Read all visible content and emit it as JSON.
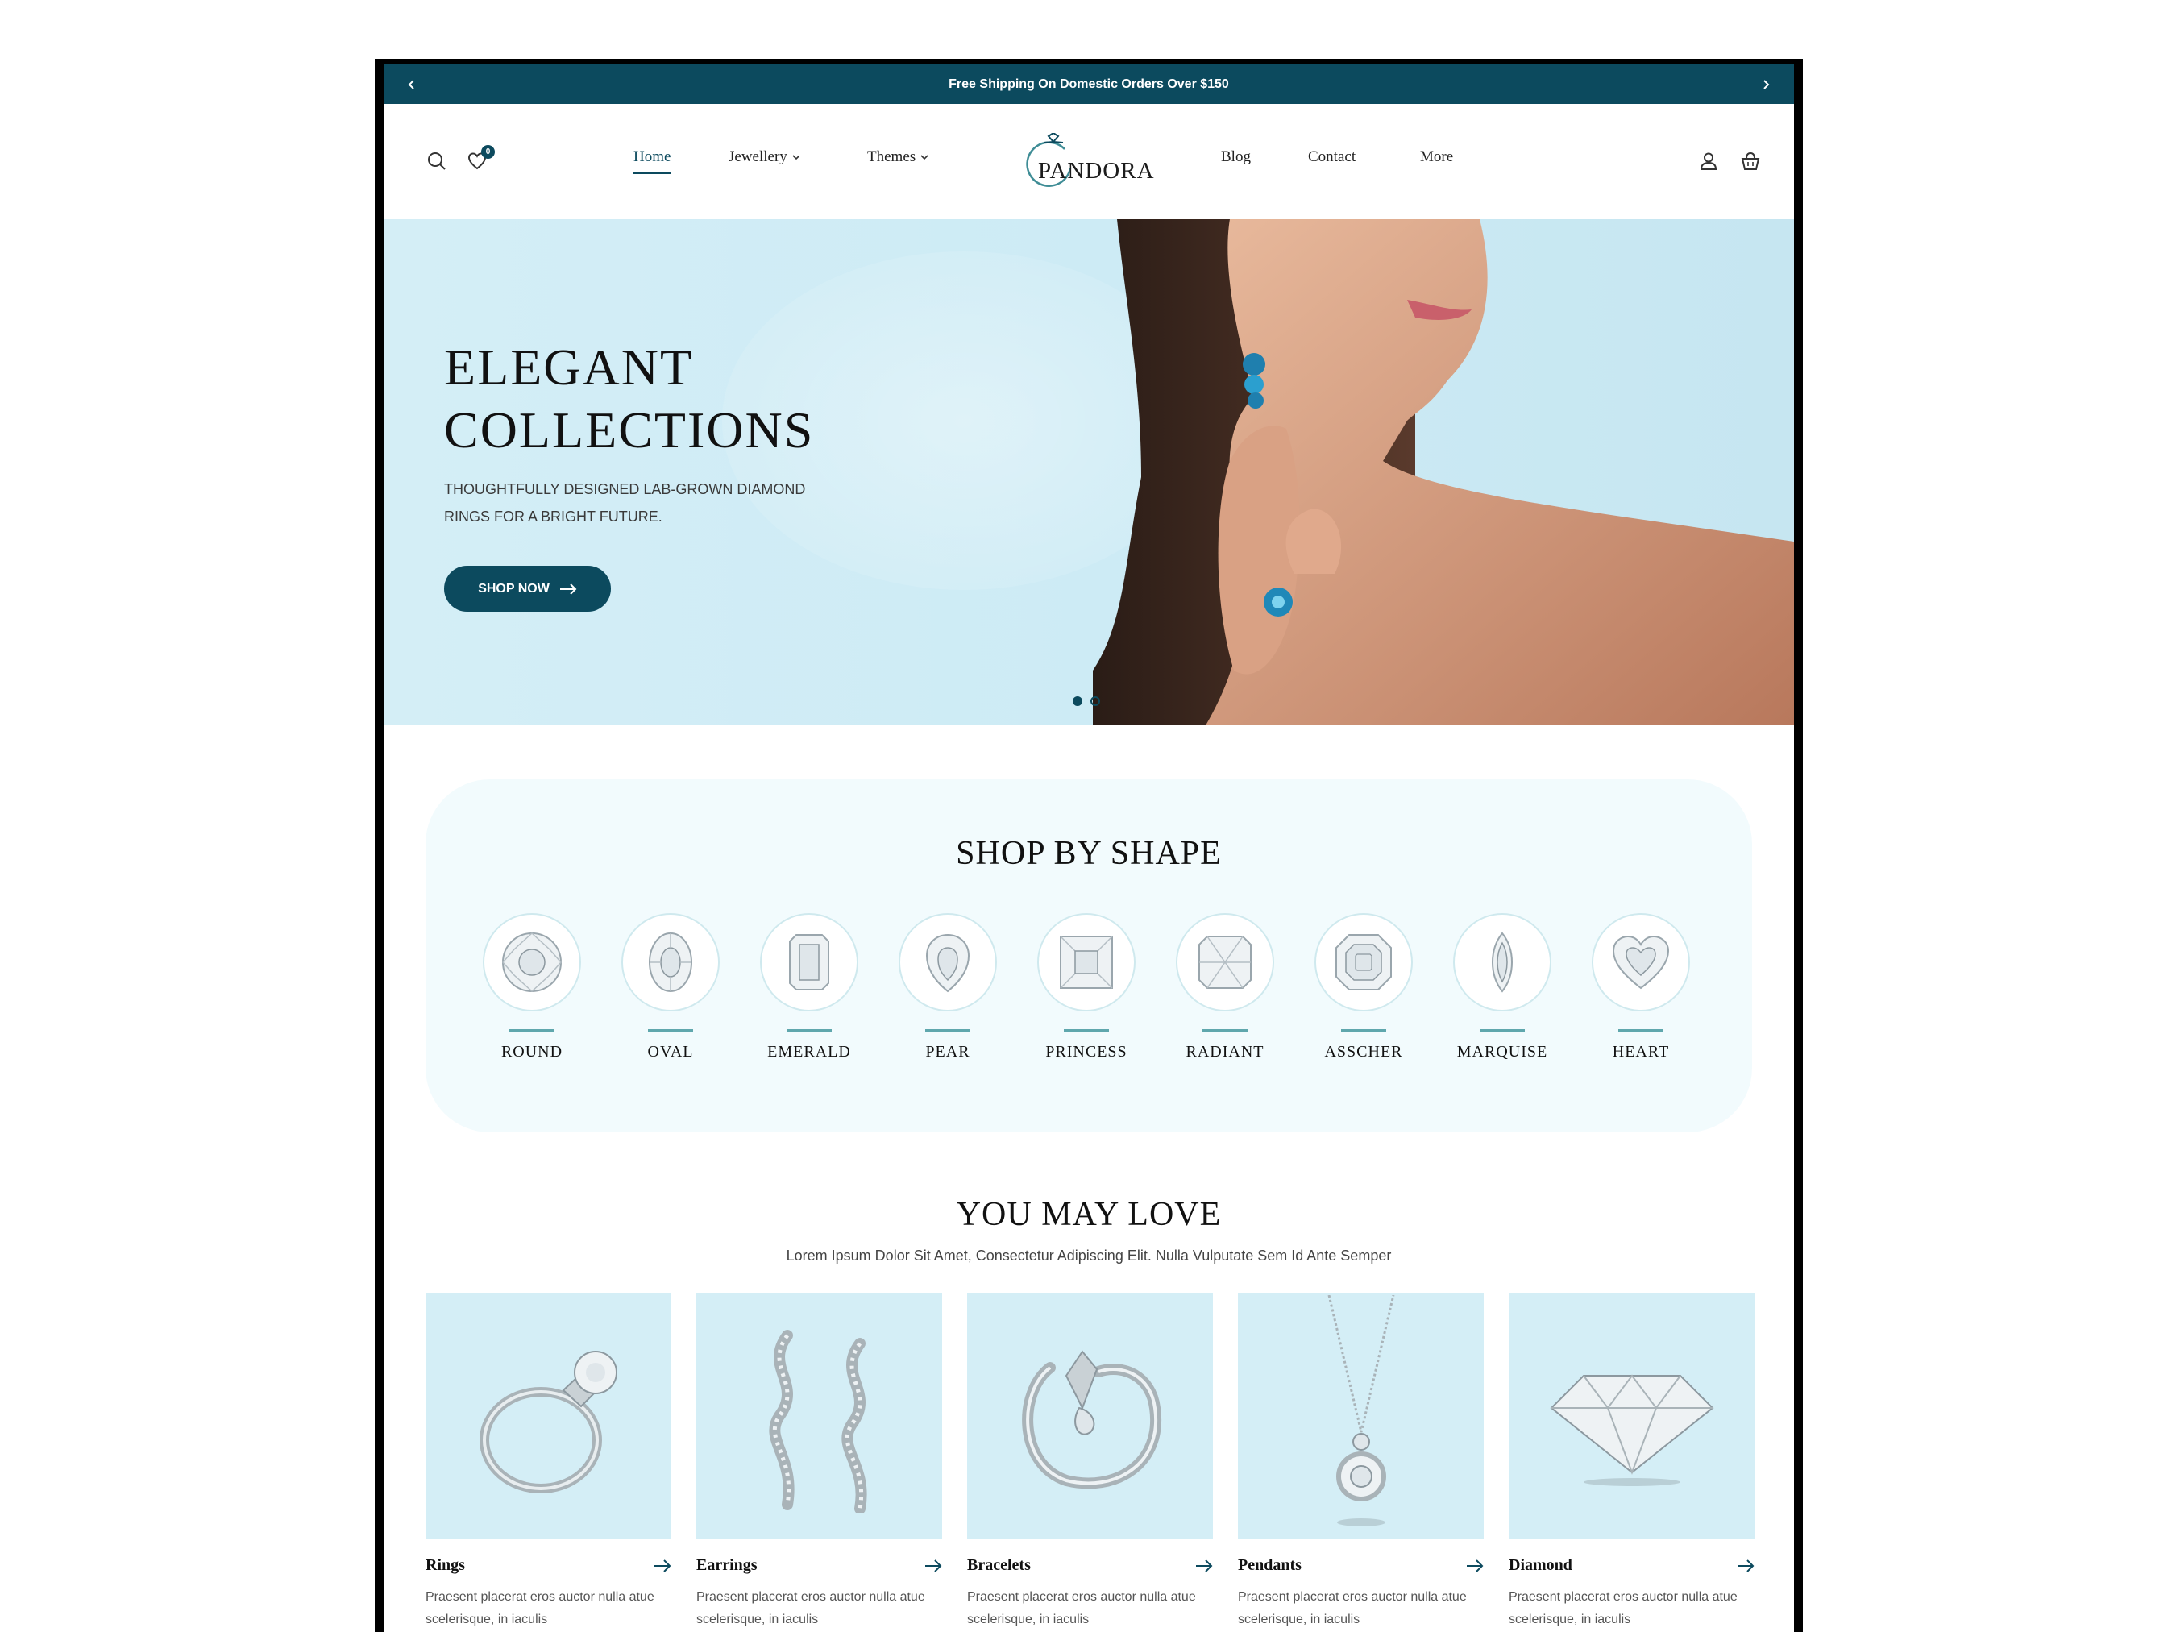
{
  "announcement": {
    "message": "Free Shipping On Domestic Orders Over $150",
    "prev_icon": "chevron-left-icon",
    "next_icon": "chevron-right-icon"
  },
  "header": {
    "logo": "PANDORA",
    "wishlist_count": "0",
    "nav": [
      {
        "label": "Home",
        "active": true
      },
      {
        "label": "Jewellery",
        "dropdown": true
      },
      {
        "label": "Themes",
        "dropdown": true
      },
      {
        "label": "Blog"
      },
      {
        "label": "Contact"
      },
      {
        "label": "More"
      }
    ],
    "icons": [
      "search-icon",
      "heart-icon",
      "user-icon",
      "shopping-bag-icon"
    ]
  },
  "hero": {
    "title_line1": "ELEGANT",
    "title_line2": "COLLECTIONS",
    "subtitle": "Thoughtfully designed lab-grown diamond rings for a bright future.",
    "button_label": "SHOP NOW",
    "slides": 2,
    "active_slide": 1
  },
  "shop_by_shape": {
    "title": "SHOP BY SHAPE",
    "shapes": [
      "ROUND",
      "OVAL",
      "EMERALD",
      "PEAR",
      "PRINCESS",
      "RADIANT",
      "ASSCHER",
      "MARQUISE",
      "HEART"
    ]
  },
  "you_may_love": {
    "title": "YOU MAY LOVE",
    "subtitle": "Lorem Ipsum Dolor Sit Amet, Consectetur Adipiscing Elit. Nulla Vulputate Sem Id Ante Semper",
    "products": [
      {
        "name": "Rings",
        "description": "Praesent placerat eros auctor nulla atue scelerisque, in iaculis"
      },
      {
        "name": "Earrings",
        "description": "Praesent placerat eros auctor nulla atue scelerisque, in iaculis"
      },
      {
        "name": "Bracelets",
        "description": "Praesent placerat eros auctor nulla atue scelerisque, in iaculis"
      },
      {
        "name": "Pendants",
        "description": "Praesent placerat eros auctor nulla atue scelerisque, in iaculis"
      },
      {
        "name": "Diamond",
        "description": "Praesent placerat eros auctor nulla atue scelerisque, in iaculis"
      }
    ]
  },
  "colors": {
    "brand": "#0c4a5e",
    "hero_bg": "#d4eef6",
    "shape_panel_bg": "#f2fbfd",
    "accent_line": "#5fa7ad"
  }
}
